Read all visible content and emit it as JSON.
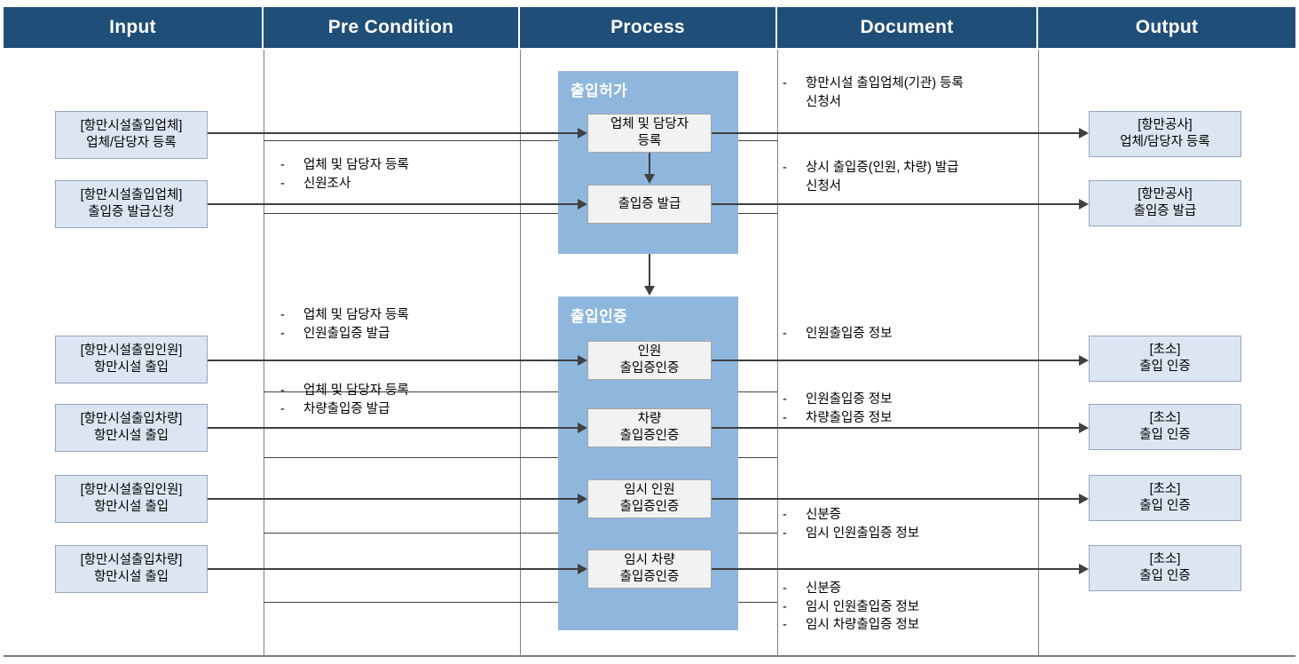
{
  "header": {
    "columns": [
      {
        "label": "Input"
      },
      {
        "label": "Pre Condition"
      },
      {
        "label": "Process"
      },
      {
        "label": "Document"
      },
      {
        "label": "Output"
      }
    ],
    "background_color": "#1F4E79",
    "text_color": "#FFFFFF"
  },
  "colors": {
    "header_bg": "#1F4E79",
    "io_box_bg": "#DCE6F2",
    "io_box_border": "#95A5BF",
    "process_group_bg": "#8FB7DE",
    "process_box_bg": "#F2F2F2",
    "process_box_border": "#A6A6A6",
    "connector": "#404040",
    "grid_line": "#808080"
  },
  "input": {
    "items": [
      {
        "id": "in-1",
        "text": "[항만시설출입업체]\n업체/담당자 등록"
      },
      {
        "id": "in-2",
        "text": "[항만시설출입업체]\n출입증 발급신청"
      },
      {
        "id": "in-3",
        "text": "[항만시설출입인원]\n항만시설 출입"
      },
      {
        "id": "in-4",
        "text": "[항만시설출입차량]\n항만시설 출입"
      },
      {
        "id": "in-5",
        "text": "[항만시설출입인원]\n항만시설 출입"
      },
      {
        "id": "in-6",
        "text": "[항만시설출입차량]\n항만시설 출입"
      }
    ]
  },
  "pre_condition": {
    "blocks": [
      {
        "id": "pc-1",
        "lines": [
          "업체 및 담당자 등록",
          "신원조사"
        ]
      },
      {
        "id": "pc-2",
        "lines": [
          "업체 및 담당자 등록",
          "인원출입증 발급"
        ]
      },
      {
        "id": "pc-3",
        "lines": [
          "업체 및 담당자 등록",
          "차량출입증 발급"
        ]
      }
    ]
  },
  "process": {
    "groups": [
      {
        "id": "grp-1",
        "title": "출입허가",
        "boxes": [
          {
            "id": "p-1",
            "text": "업체 및 담당자\n등록"
          },
          {
            "id": "p-2",
            "text": "출입증 발급"
          }
        ]
      },
      {
        "id": "grp-2",
        "title": "출입인증",
        "boxes": [
          {
            "id": "p-3",
            "text": "인원\n출입증인증"
          },
          {
            "id": "p-4",
            "text": "차량\n출입증인증"
          },
          {
            "id": "p-5",
            "text": "임시 인원\n출입증인증"
          },
          {
            "id": "p-6",
            "text": "임시 차량\n출입증인증"
          }
        ]
      }
    ]
  },
  "document": {
    "blocks": [
      {
        "id": "doc-1",
        "lines": [
          "항만시설 출입업체(기관) 등록\n신청서"
        ]
      },
      {
        "id": "doc-2",
        "lines": [
          "상시 출입증(인원, 차량) 발급\n신청서"
        ]
      },
      {
        "id": "doc-3",
        "lines": [
          "인원출입증 정보"
        ]
      },
      {
        "id": "doc-4",
        "lines": [
          "인원출입증 정보",
          "차량출입증 정보"
        ]
      },
      {
        "id": "doc-5",
        "lines": [
          "신분증",
          "임시 인원출입증 정보"
        ]
      },
      {
        "id": "doc-6",
        "lines": [
          "신분증",
          "임시 인원출입증 정보",
          "임시 차량출입증 정보"
        ]
      }
    ]
  },
  "output": {
    "items": [
      {
        "id": "out-1",
        "text": "[항만공사]\n업체/담당자 등록"
      },
      {
        "id": "out-2",
        "text": "[항만공사]\n출입증 발급"
      },
      {
        "id": "out-3",
        "text": "[초소]\n출입 인증"
      },
      {
        "id": "out-4",
        "text": "[초소]\n출입 인증"
      },
      {
        "id": "out-5",
        "text": "[초소]\n출입 인증"
      },
      {
        "id": "out-6",
        "text": "[초소]\n출입 인증"
      }
    ]
  }
}
